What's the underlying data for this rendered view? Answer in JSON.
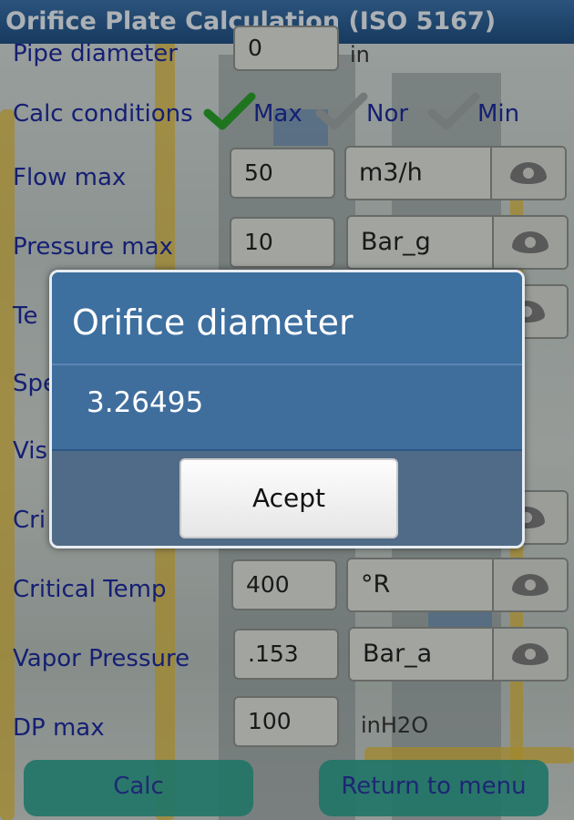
{
  "title": "Orifice Plate Calculation (ISO 5167)",
  "pipe_diameter": {
    "label": "Pipe diameter",
    "value": "0",
    "unit": "in"
  },
  "calc_conditions": {
    "label": "Calc conditions",
    "options": [
      {
        "label": "Max",
        "checked": true
      },
      {
        "label": "Nor",
        "checked": false
      },
      {
        "label": "Min",
        "checked": false
      }
    ]
  },
  "rows": [
    {
      "label": "Flow max",
      "value": "50",
      "unit": "m3/h"
    },
    {
      "label": "Pressure max",
      "value": "10",
      "unit": "Bar_g"
    },
    {
      "label": "Te",
      "value": "",
      "unit": ""
    },
    {
      "label": "Spe",
      "value": "",
      "unit": ""
    },
    {
      "label": "Vis",
      "value": "",
      "unit": ""
    },
    {
      "label": "Cri",
      "value": "",
      "unit": ""
    },
    {
      "label": "Critical Temp",
      "value": "400",
      "unit": "°R"
    },
    {
      "label": "Vapor Pressure",
      "value": ".153",
      "unit": "Bar_a"
    }
  ],
  "dp_max": {
    "label": "DP max",
    "value": "100",
    "unit": "inH2O"
  },
  "buttons": {
    "calc": "Calc",
    "return": "Return to menu"
  },
  "dialog": {
    "title": "Orifice diameter",
    "message": "3.26495",
    "button": "Acept"
  },
  "colors": {
    "title_bar": "#1f4e80",
    "label_text": "#1c2a9a",
    "dialog_bg": "#3d6f9f",
    "bottom_button": "#2e9d8b"
  }
}
